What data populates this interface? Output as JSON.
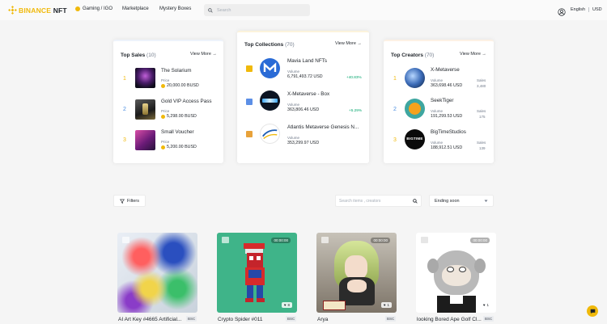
{
  "header": {
    "logo_brand": "BINANCE",
    "logo_product": "NFT",
    "nav": [
      "Gaming / IGO",
      "Marketplace",
      "Mystery Boxes"
    ],
    "search_placeholder": "Search",
    "language": "English",
    "currency": "USD"
  },
  "top_sales": {
    "title": "Top Sales",
    "count": "(10)",
    "view_more": "View More →",
    "items": [
      {
        "rank": "1",
        "name": "The Solarium",
        "price_label": "Price",
        "price": "20,000.00 BUSD"
      },
      {
        "rank": "2",
        "name": "Gold VIP Access Pass",
        "price_label": "Price",
        "price": "5,298.00 BUSD"
      },
      {
        "rank": "3",
        "name": "Small Voucher",
        "price_label": "Price",
        "price": "5,200.00 BUSD"
      }
    ]
  },
  "top_collections": {
    "title": "Top Collections",
    "count": "(70)",
    "view_more": "View More →",
    "items": [
      {
        "name": "Mavia Land NFTs",
        "volume_label": "Volume",
        "volume": "6,791,493.72 USD",
        "change": "+40.83%"
      },
      {
        "name": "X-Metaverse - Box",
        "volume_label": "Volume",
        "volume": "363,806.46 USD",
        "change": "+5.29%"
      },
      {
        "name": "Atlantis Metaverse Genesis N...",
        "volume_label": "Volume",
        "volume": "353,299.97 USD",
        "change": ""
      }
    ]
  },
  "top_creators": {
    "title": "Top Creators",
    "count": "(70)",
    "view_more": "View More →",
    "items": [
      {
        "rank": "1",
        "name": "X-Metaverse",
        "volume_label": "Volume",
        "volume": "363,698.46 USD",
        "sales_label": "Sales",
        "sales": "3,480"
      },
      {
        "rank": "2",
        "name": "SeekTiger",
        "volume_label": "Volume",
        "volume": "191,299.53 USD",
        "sales_label": "Sales",
        "sales": "175"
      },
      {
        "rank": "3",
        "name": "BigTimeStudios",
        "volume_label": "Volume",
        "volume": "188,912.51 USD",
        "sales_label": "Sales",
        "sales": "139"
      }
    ]
  },
  "toolbar": {
    "filters_label": "Filters",
    "search_placeholder": "Search items , creators",
    "sort_value": "Ending soon"
  },
  "nfts": [
    {
      "name": "AI Art Key #4665 Artificial...",
      "chain": "BSC",
      "likes": "",
      "timer": ""
    },
    {
      "name": "Crypto Spider #011",
      "chain": "BSC",
      "likes": "8",
      "timer": "00:00:00"
    },
    {
      "name": "Arya",
      "chain": "BSC",
      "likes": "1",
      "timer": "00:00:00"
    },
    {
      "name": "looking Bored Ape Golf Cl...",
      "chain": "BSC",
      "likes": "1",
      "timer": "00:00:00"
    }
  ],
  "creator_avatar_text": {
    "bigtime": "BIGTIME"
  },
  "colors": {
    "brand": "#F0B90B",
    "positive": "#03A66D",
    "text": "#1E2329",
    "muted": "#707A8A"
  }
}
